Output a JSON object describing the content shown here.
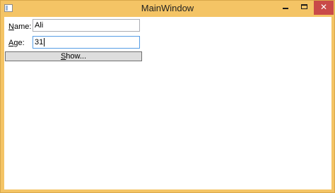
{
  "window": {
    "title": "MainWindow",
    "controls": {
      "minimize": "minimize",
      "maximize": "maximize",
      "close": "✕"
    }
  },
  "form": {
    "name_label_access": "N",
    "name_label_rest": "ame:",
    "name_value": "Ali",
    "age_label_access": "A",
    "age_label_rest": "ge:",
    "age_value": "31",
    "show_button_access": "S",
    "show_button_rest": "how..."
  },
  "colors": {
    "title_bar": "#f4c465",
    "close_button": "#c94a48",
    "focus_border": "#569de5"
  }
}
